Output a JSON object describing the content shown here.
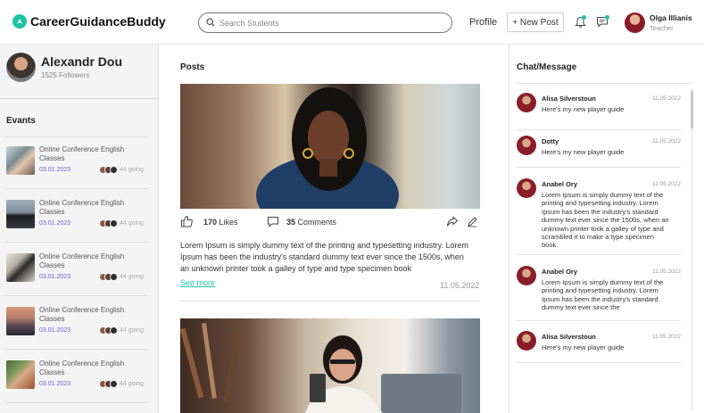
{
  "header": {
    "brand": "CareerGuidanceBuddy",
    "search_placeholder": "Search Students",
    "profile_label": "Profile",
    "new_post_label": "+ New Post",
    "user_name": "Olga Illianis",
    "user_role": "Teacher"
  },
  "colors": {
    "accent": "#1fc4a1",
    "date_blue": "#6a5fd6"
  },
  "profile": {
    "name": "Alexandr Dou",
    "followers": "1525 Followers"
  },
  "events": {
    "title": "Evants",
    "items": [
      {
        "title": "Online Conference English Classes",
        "date": "03.01.2023",
        "going": "44 going"
      },
      {
        "title": "Online Conference English Classes",
        "date": "03.01.2023",
        "going": "44 going"
      },
      {
        "title": "Online Conference English Classes",
        "date": "03.01.2023",
        "going": "44 going"
      },
      {
        "title": "Online Conference English Classes",
        "date": "03.01.2023",
        "going": "44 going"
      },
      {
        "title": "Online Conference English Classes",
        "date": "03.01.2023",
        "going": "44 going"
      }
    ]
  },
  "posts": {
    "title": "Posts",
    "items": [
      {
        "likes_count": "170",
        "likes_label": "Likes",
        "comments_count": "35",
        "comments_label": "Comments",
        "text": "Lorem Ipsum is simply dummy text of the printing and typesetting industry. Lorem Ipsum has been the industry's standard dummy text ever since the 1500s, when an unknown printer took a galley of type and type specimen book",
        "see_more": "See more",
        "date": "11.05.2022"
      }
    ]
  },
  "chat": {
    "title": "Chat/Message",
    "messages": [
      {
        "name": "Alisa Silverstoun",
        "date": "11.05.2022",
        "text": "Here's my new player guide"
      },
      {
        "name": "Dotty",
        "date": "11.05.2022",
        "text": "Here's my new player guide"
      },
      {
        "name": "Anabel Ory",
        "date": "11.05.2022",
        "text": "Lorem Ipsum is simply dummy text of the printing and typesetting industry. Lorem Ipsum has been the industry's standard dummy text ever since the 1500s, when an unknown printer took a galley of type and scrambled it to make a type specimen book."
      },
      {
        "name": "Anabel Ory",
        "date": "11.05.2022",
        "text": "Lorem Ipsum is simply dummy text of the printing and typesetting industry. Lorem Ipsum has been the industry's standard dummy text ever since the"
      },
      {
        "name": "Alisa Silverstoun",
        "date": "11.05.2022",
        "text": "Here's my new player guide"
      }
    ]
  }
}
